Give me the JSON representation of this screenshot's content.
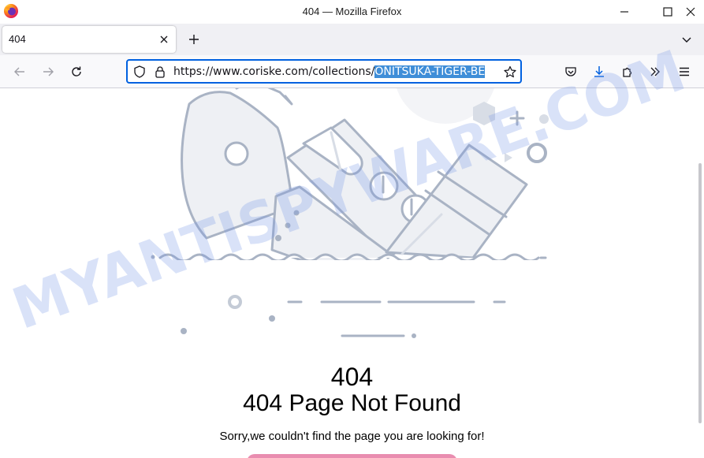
{
  "window": {
    "title": "404 — Mozilla Firefox"
  },
  "tabs": [
    {
      "label": "404"
    }
  ],
  "navbar": {
    "url_plain": "https://www.coriske.com/collections/",
    "url_selected": "ONITSUKA-TIGER-BE"
  },
  "page": {
    "code": "404",
    "heading": "404 Page Not Found",
    "message": "Sorry,we couldn't find the page you are looking for!"
  },
  "watermark": {
    "text": "MYANTISPYWARE.COM"
  },
  "icons": {
    "app": "firefox-icon",
    "minimize": "minimize-icon",
    "maximize": "maximize-icon",
    "close": "close-icon",
    "tab_close": "tab-close-icon",
    "new_tab": "plus-icon",
    "tab_list": "chevron-down-icon",
    "back": "back-arrow-icon",
    "forward": "forward-arrow-icon",
    "reload": "reload-icon",
    "shield": "shield-icon",
    "lock": "lock-icon",
    "bookmark": "star-icon",
    "pocket": "pocket-icon",
    "downloads": "download-icon",
    "extensions": "puzzle-icon",
    "overflow": "double-chevron-icon",
    "menu": "hamburger-menu-icon"
  },
  "colors": {
    "accent": "#0061e0",
    "selection": "#3f8ed8",
    "button": "#e98db0",
    "illustration": "#a9b3c4"
  }
}
